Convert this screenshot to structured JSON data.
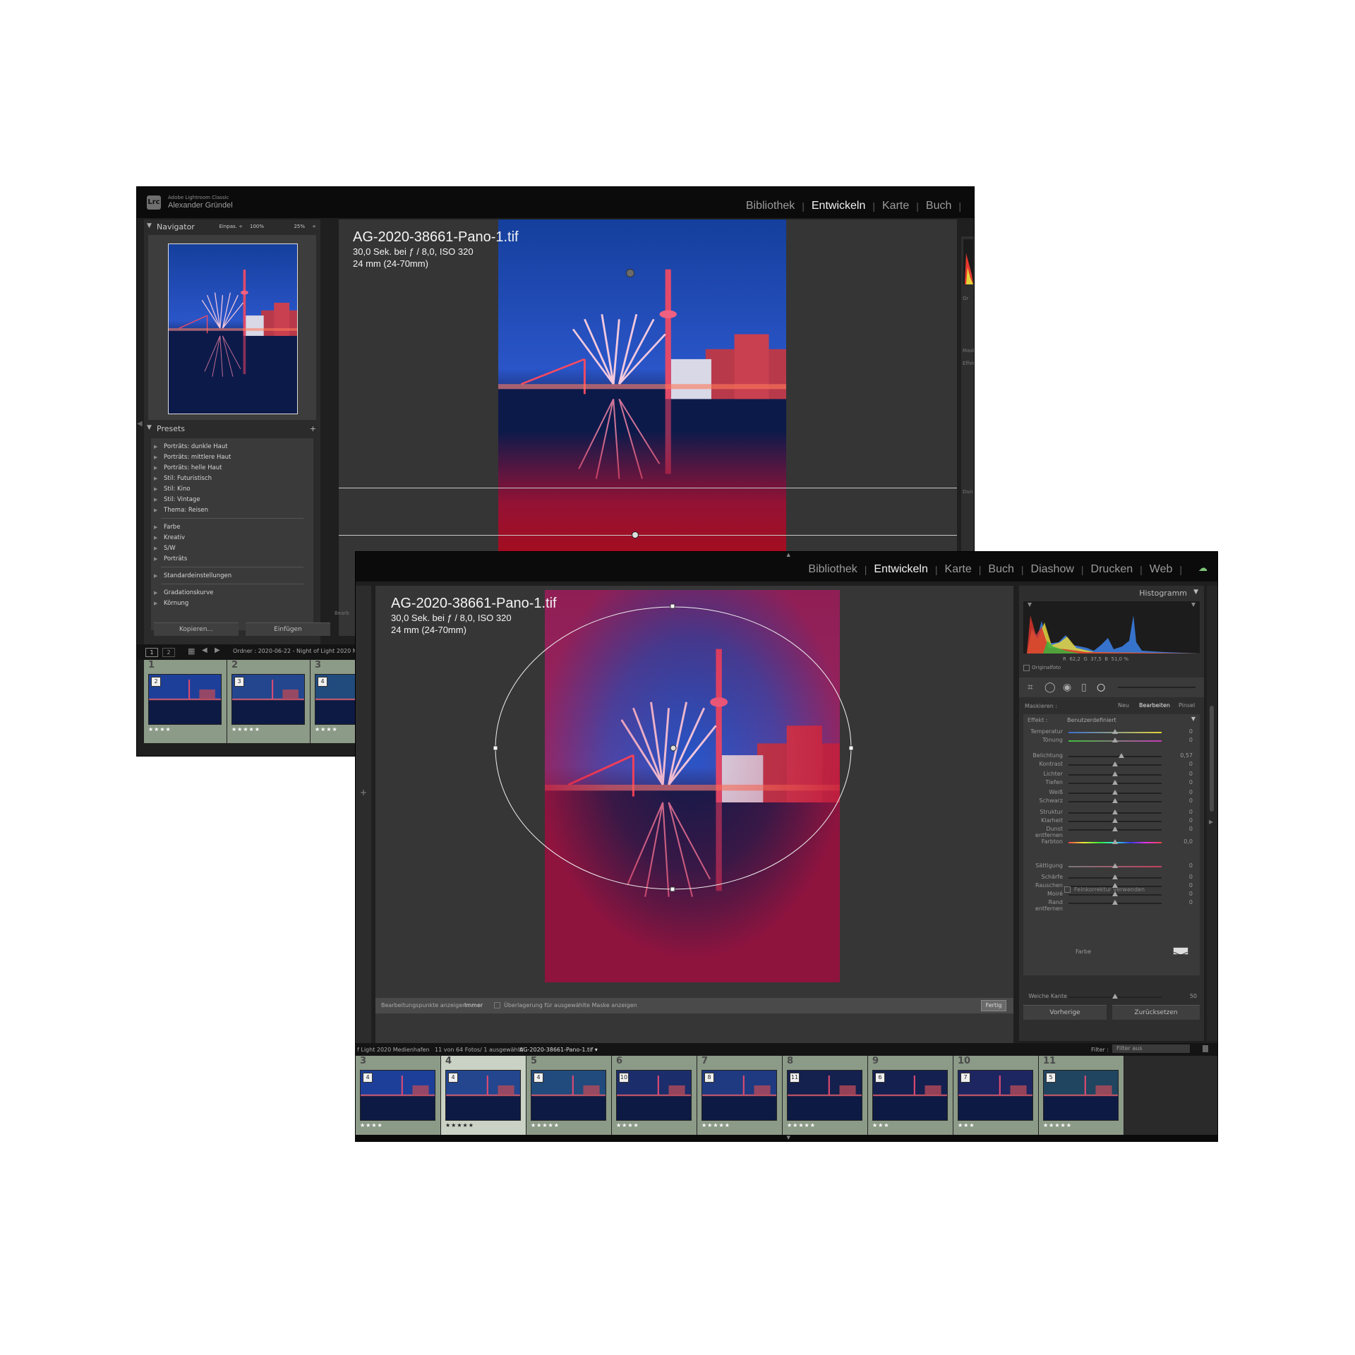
{
  "back_window": {
    "app_label": "Adobe Lightroom Classic",
    "app_badge": "Lrc",
    "user_name": "Alexander Gründel",
    "modules": [
      "Bibliothek",
      "Entwickeln",
      "Karte",
      "Buch"
    ],
    "active_module": "Entwickeln",
    "navigator": {
      "title": "Navigator",
      "zoom_options": [
        "Einpas. ÷",
        "100%",
        "25%",
        "÷"
      ]
    },
    "presets": {
      "title": "Presets",
      "add_label": "+",
      "group1": [
        "Porträts: dunkle Haut",
        "Porträts: mittlere Haut",
        "Porträts: helle Haut",
        "Stil: Futuristisch",
        "Stil: Kino",
        "Stil: Vintage",
        "Thema: Reisen"
      ],
      "group2": [
        "Farbe",
        "Kreativ",
        "S/W",
        "Porträts"
      ],
      "group3": [
        "Standardeinstellungen"
      ],
      "group4": [
        "Gradationskurve",
        "Körnung"
      ]
    },
    "copy_button": "Kopieren...",
    "paste_button": "Einfügen",
    "photo": {
      "filename": "AG-2020-38661-Pano-1.tif",
      "exposure_info": "30,0 Sek. bei ƒ / 8,0, ISO 320",
      "lens_info": "24 mm (24-70mm)"
    },
    "filmstrip": {
      "view_numbers": [
        "1",
        "2"
      ],
      "folder_path": "Ordner : 2020-06-22 - Night of Light 2020 M",
      "cells": [
        {
          "index": "1",
          "badge": "2",
          "stars": "★★★★"
        },
        {
          "index": "2",
          "badge": "3",
          "stars": "★★★★★"
        },
        {
          "index": "3",
          "badge": "4",
          "stars": "★★★★"
        }
      ]
    },
    "right_peek": [
      "Or",
      "Mask",
      "Effekt",
      "Dun"
    ],
    "left_bottom_peek": "Bearb"
  },
  "front_window": {
    "modules": [
      "Bibliothek",
      "Entwickeln",
      "Karte",
      "Buch",
      "Diashow",
      "Drucken",
      "Web"
    ],
    "active_module": "Entwickeln",
    "photo": {
      "filename": "AG-2020-38661-Pano-1.tif",
      "exposure_info": "30,0 Sek. bei ƒ / 8,0, ISO 320",
      "lens_info": "24 mm (24-70mm)"
    },
    "toolbar": {
      "edit_points_label": "Bearbeitungspunkte anzeigen :",
      "edit_points_value": "Immer",
      "overlay_label": "Überlagerung für ausgewählte Maske anzeigen",
      "done_button": "Fertig"
    },
    "histogram": {
      "title": "Histogramm",
      "rgb_label": "R  62,2  G  37,5  B  51,0 %",
      "original_label": "Originalfoto"
    },
    "mask": {
      "title": "Maskieren :",
      "tabs": [
        "Neu",
        "Bearbeiten",
        "Pinsel"
      ],
      "active_tab": "Bearbeiten",
      "effect_label": "Effekt :",
      "effect_value": "Benutzerdefiniert",
      "sliders": [
        {
          "label": "Temperatur",
          "value": "0",
          "pos": 0.5,
          "track": "temp"
        },
        {
          "label": "Tönung",
          "value": "0",
          "pos": 0.5,
          "track": "tint"
        },
        {
          "label": "Belichtung",
          "value": "0,57",
          "pos": 0.57,
          "track": "plain"
        },
        {
          "label": "Kontrast",
          "value": "0",
          "pos": 0.5,
          "track": "plain"
        },
        {
          "label": "Lichter",
          "value": "0",
          "pos": 0.5,
          "track": "plain"
        },
        {
          "label": "Tiefen",
          "value": "0",
          "pos": 0.5,
          "track": "plain"
        },
        {
          "label": "Weiß",
          "value": "0",
          "pos": 0.5,
          "track": "plain"
        },
        {
          "label": "Schwarz",
          "value": "0",
          "pos": 0.5,
          "track": "plain"
        },
        {
          "label": "Struktur",
          "value": "0",
          "pos": 0.5,
          "track": "plain"
        },
        {
          "label": "Klarheit",
          "value": "0",
          "pos": 0.5,
          "track": "plain"
        },
        {
          "label": "Dunst entfernen",
          "value": "0",
          "pos": 0.5,
          "track": "plain"
        },
        {
          "label": "Farbton",
          "value": "0,0",
          "pos": 0.5,
          "track": "hue"
        },
        {
          "label": "Sättigung",
          "value": "0",
          "pos": 0.5,
          "track": "sat"
        },
        {
          "label": "Schärfe",
          "value": "0",
          "pos": 0.5,
          "track": "plain"
        },
        {
          "label": "Rauschen",
          "value": "0",
          "pos": 0.5,
          "track": "plain"
        },
        {
          "label": "Moiré",
          "value": "0",
          "pos": 0.5,
          "track": "plain"
        },
        {
          "label": "Rand entfernen",
          "value": "0",
          "pos": 0.5,
          "track": "plain"
        }
      ],
      "fine_label": "Feinkorrektur verwenden",
      "color_label": "Farbe",
      "feather_label": "Weiche Kante",
      "feather_value": "50",
      "feather_pos": 0.5
    },
    "prev_button": "Vorherige",
    "reset_button": "Zurücksetzen",
    "filmstrip": {
      "breadcrumb": "f Light 2020 Medienhafen",
      "count": "11 von 64 Fotos/ 1 ausgewählt/",
      "current_file": "AG-2020-38661-Pano-1.tif ▾",
      "filter_label": "Filter :",
      "filter_value": "Filter aus",
      "cells": [
        {
          "index": "3",
          "badge": "4",
          "stars": "★★★★"
        },
        {
          "index": "4",
          "badge": "4",
          "stars": "★★★★★"
        },
        {
          "index": "5",
          "badge": "4",
          "stars": "★★★★★"
        },
        {
          "index": "6",
          "badge": "10",
          "stars": "★★★★"
        },
        {
          "index": "7",
          "badge": "8",
          "stars": "★★★★★"
        },
        {
          "index": "8",
          "badge": "11",
          "stars": "★★★★★"
        },
        {
          "index": "9",
          "badge": "6",
          "stars": "★★★"
        },
        {
          "index": "10",
          "badge": "7",
          "stars": "★★★"
        },
        {
          "index": "11",
          "badge": "5",
          "stars": "★★★★★"
        }
      ]
    }
  },
  "colors": {
    "mask_overlay": "#c0123a",
    "cell_green": "#8c9a88",
    "selected_cell": "#c9d2c4"
  }
}
